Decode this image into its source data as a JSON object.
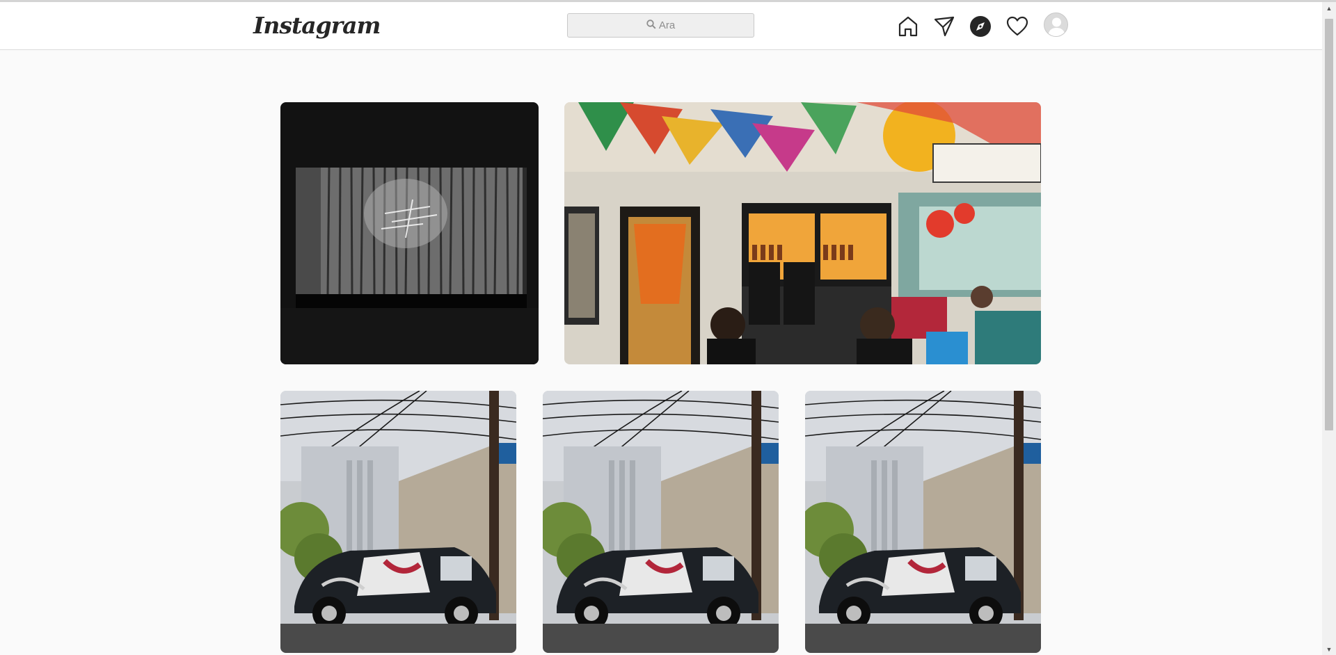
{
  "app": {
    "logo_text": "Instagram"
  },
  "search": {
    "placeholder": "Ara",
    "icon": "search-icon"
  },
  "nav": {
    "icons": [
      "home-icon",
      "direct-message-icon",
      "explore-icon",
      "activity-heart-icon",
      "profile-avatar"
    ]
  },
  "feed": {
    "rows": [
      {
        "posts": [
          {
            "subject": "theater-curtain-bw"
          },
          {
            "subject": "colorful-cafe-interior"
          }
        ]
      },
      {
        "posts": [
          {
            "subject": "graffiti-van"
          },
          {
            "subject": "graffiti-van"
          },
          {
            "subject": "graffiti-van"
          }
        ]
      }
    ]
  },
  "colors": {
    "header_bg": "#ffffff",
    "page_bg": "#fafafa",
    "border": "#dbdbdb"
  }
}
